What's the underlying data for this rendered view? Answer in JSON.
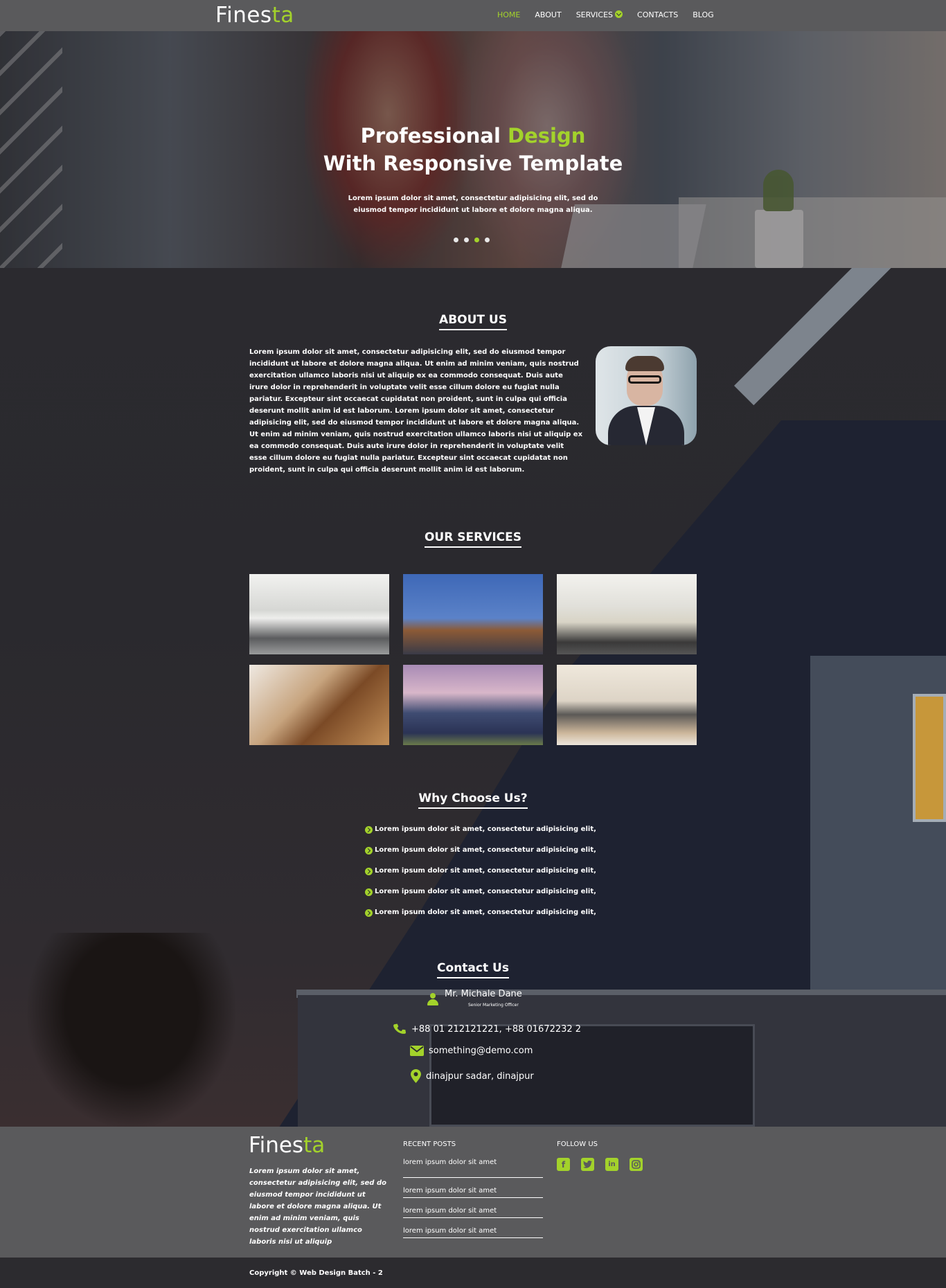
{
  "brand": {
    "name_main": "Fines",
    "name_accent": "ta",
    "accent_color": "#a3d22b"
  },
  "nav": {
    "items": [
      {
        "label": "HOME",
        "active": true
      },
      {
        "label": "ABOUT",
        "active": false
      },
      {
        "label": "SERVICES",
        "active": false,
        "has_dropdown": true
      },
      {
        "label": "CONTACTS",
        "active": false
      },
      {
        "label": "BLOG",
        "active": false
      }
    ]
  },
  "hero": {
    "title_line1_plain": "Professional ",
    "title_line1_accent": "Design",
    "title_line2": "With Responsive Template",
    "subtitle": "Lorem ipsum dolor sit amet, consectetur adipisicing elit, sed do eiusmod tempor incididunt ut labore et dolore magna aliqua.",
    "slide_count": 4,
    "active_slide": 3
  },
  "about": {
    "title": "ABOUT US",
    "text": "Lorem ipsum dolor sit amet, consectetur adipisicing elit, sed do eiusmod tempor incididunt ut labore et dolore magna aliqua. Ut enim ad minim veniam, quis nostrud exercitation ullamco laboris nisi ut aliquip ex ea commodo consequat. Duis aute irure dolor in reprehenderit in voluptate velit esse cillum dolore eu fugiat nulla pariatur. Excepteur sint occaecat cupidatat non proident, sunt in culpa qui officia deserunt mollit anim id est laborum. Lorem ipsum dolor sit amet, consectetur adipisicing elit, sed do eiusmod tempor incididunt ut labore et dolore magna aliqua. Ut enim ad minim veniam, quis nostrud exercitation ullamco laboris nisi ut aliquip ex ea commodo consequat. Duis aute irure dolor in reprehenderit in voluptate velit esse cillum dolore eu fugiat nulla pariatur. Excepteur sint occaecat cupidatat non proident, sunt in culpa qui officia deserunt mollit anim id est laborum."
  },
  "services": {
    "title": "OUR SERVICES",
    "images": [
      "kitchen",
      "office",
      "living-room",
      "staircase",
      "house",
      "lounge"
    ]
  },
  "why": {
    "title": "Why Choose Us?",
    "items": [
      "Lorem ipsum dolor sit amet, consectetur adipisicing elit,",
      "Lorem ipsum dolor sit amet, consectetur adipisicing elit,",
      "Lorem ipsum dolor sit amet, consectetur adipisicing elit,",
      "Lorem ipsum dolor sit amet, consectetur adipisicing elit,",
      "Lorem ipsum dolor sit amet, consectetur adipisicing elit,"
    ]
  },
  "contact": {
    "title": "Contact Us",
    "name": "Mr. Michale Dane",
    "role": "Senior Marketing Officer",
    "phone": "+88 01 212121221, +88 01672232 2",
    "email": "something@demo.com",
    "location": "dinajpur sadar, dinajpur"
  },
  "footer": {
    "description": "Lorem ipsum dolor sit amet, consectetur adipisicing elit, sed do eiusmod tempor incididunt ut labore et dolore magna aliqua. Ut enim ad minim veniam, quis nostrud exercitation ullamco laboris nisi ut aliquip",
    "recent_posts_title": "RECENT POSTS",
    "posts": [
      "lorem ipsum dolor sit amet",
      "lorem ipsum dolor sit amet",
      "lorem ipsum dolor sit amet",
      "lorem ipsum dolor sit amet"
    ],
    "follow_title": "FOLLOW US",
    "socials": [
      "facebook-icon",
      "twitter-icon",
      "linkedin-icon",
      "instagram-icon"
    ],
    "copyright": "Copyright © Web Design Batch - 2"
  }
}
